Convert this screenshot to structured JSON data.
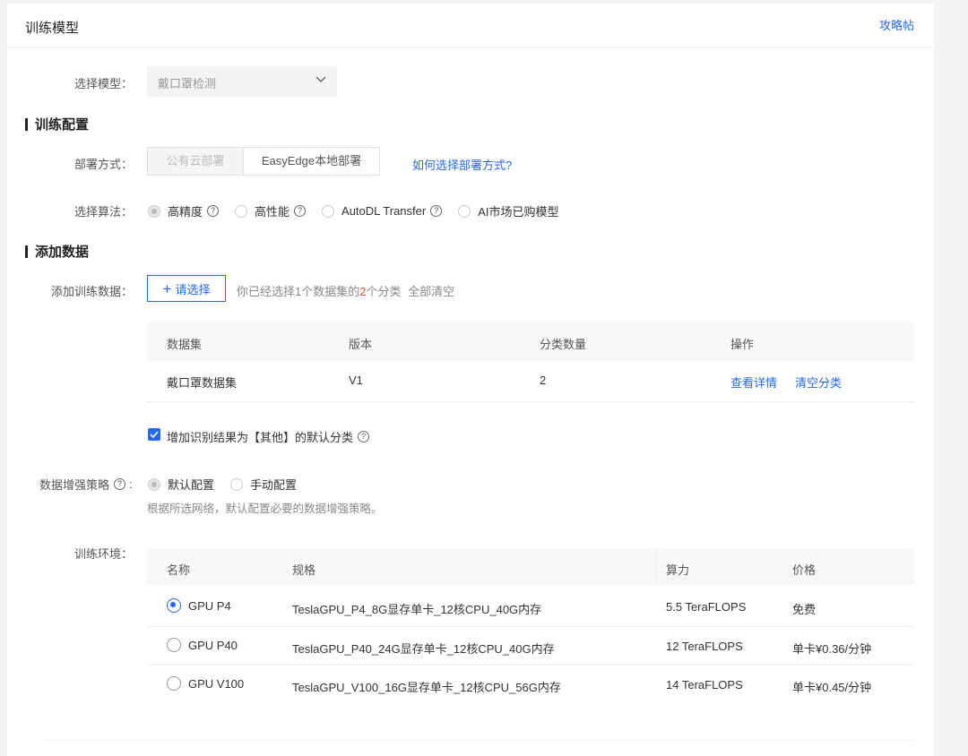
{
  "header": {
    "title": "训练模型",
    "guide_link": "攻略帖"
  },
  "model_select": {
    "label": "选择模型：",
    "value": "戴口罩检测"
  },
  "sections": {
    "train_config": "训练配置",
    "add_data": "添加数据"
  },
  "deploy": {
    "label": "部署方式：",
    "options": [
      "公有云部署",
      "EasyEdge本地部署"
    ],
    "help_link": "如何选择部署方式?"
  },
  "algorithm": {
    "label": "选择算法：",
    "options": [
      "高精度",
      "高性能",
      "AutoDL Transfer",
      "AI市场已购模型"
    ],
    "selected": "高精度"
  },
  "train_data": {
    "label": "添加训练数据：",
    "add_button": "请选择",
    "info_prefix": "你已经选择1个数据集的",
    "info_count": "2",
    "info_suffix": "个分类",
    "clear_all": "全部清空"
  },
  "dataset_table": {
    "columns": [
      "数据集",
      "版本",
      "分类数量",
      "操作"
    ],
    "rows": [
      {
        "name": "戴口罩数据集",
        "version": "V1",
        "count": "2",
        "actions": [
          "查看详情",
          "清空分类"
        ]
      }
    ]
  },
  "default_class": {
    "checked": true,
    "label": "增加识别结果为【其他】的默认分类"
  },
  "augmentation": {
    "label": "数据增强策略",
    "options": [
      "默认配置",
      "手动配置"
    ],
    "selected": "默认配置",
    "hint": "根据所选网络，默认配置必要的数据增强策略。"
  },
  "environment": {
    "label": "训练环境：",
    "columns": [
      "名称",
      "规格",
      "算力",
      "价格"
    ],
    "rows": [
      {
        "name": "GPU P4",
        "spec": "TeslaGPU_P4_8G显存单卡_12核CPU_40G内存",
        "power": "5.5 TeraFLOPS",
        "price": "免费",
        "selected": true
      },
      {
        "name": "GPU P40",
        "spec": "TeslaGPU_P40_24G显存单卡_12核CPU_40G内存",
        "power": "12 TeraFLOPS",
        "price": "单卡¥0.36/分钟",
        "selected": false
      },
      {
        "name": "GPU V100",
        "spec": "TeslaGPU_V100_16G显存单卡_12核CPU_56G内存",
        "power": "14 TeraFLOPS",
        "price": "单卡¥0.45/分钟",
        "selected": false
      }
    ]
  },
  "colors": {
    "accent": "#2468f2",
    "highlight": "#e34c3c"
  },
  "icons": {
    "dropdown": "chevron-down-icon",
    "help": "question-circle-icon",
    "add": "plus-icon",
    "check": "check-icon"
  }
}
